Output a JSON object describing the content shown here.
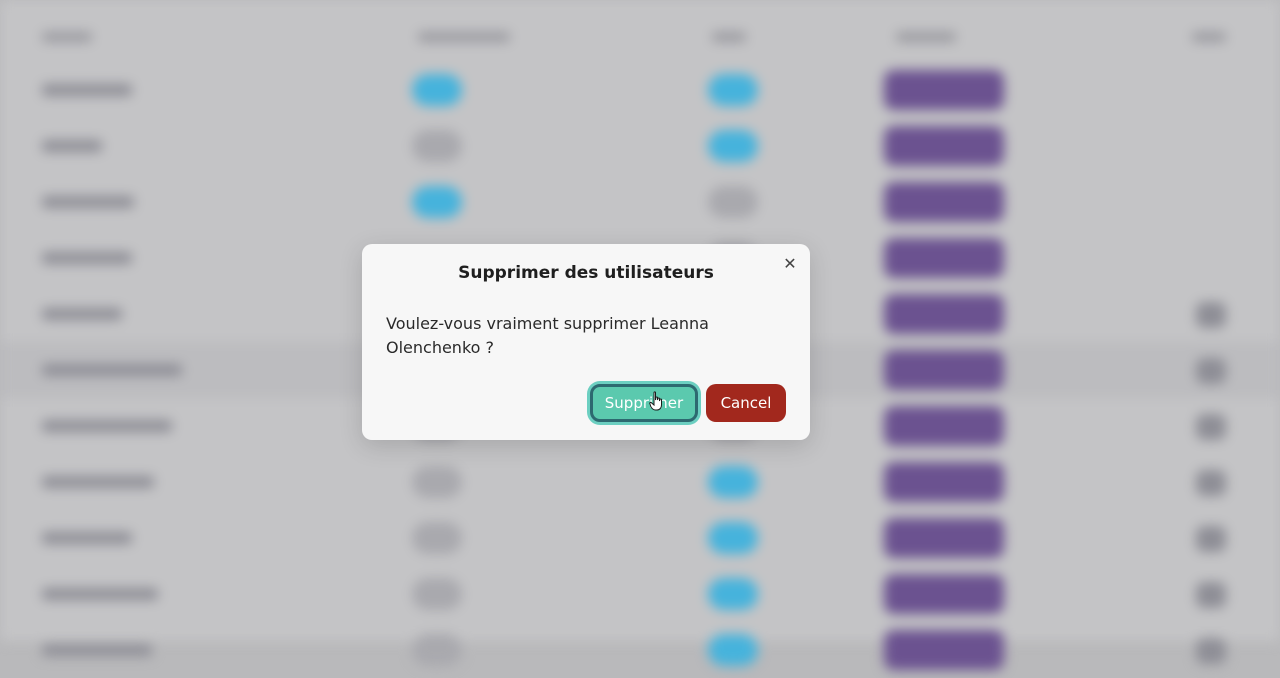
{
  "dialog": {
    "title": "Supprimer des utilisateurs",
    "message": "Voulez-vous vraiment supprimer Leanna Olenchenko ?",
    "confirm_label": "Supprimer",
    "cancel_label": "Cancel",
    "close_icon": "close-icon",
    "close_glyph": "✕"
  },
  "colors": {
    "confirm": "#5bc9ae",
    "cancel": "#a2281d",
    "role_badge": "#6b5290",
    "status_badge": "#46b3dc"
  },
  "background_table": {
    "rows": 11
  }
}
